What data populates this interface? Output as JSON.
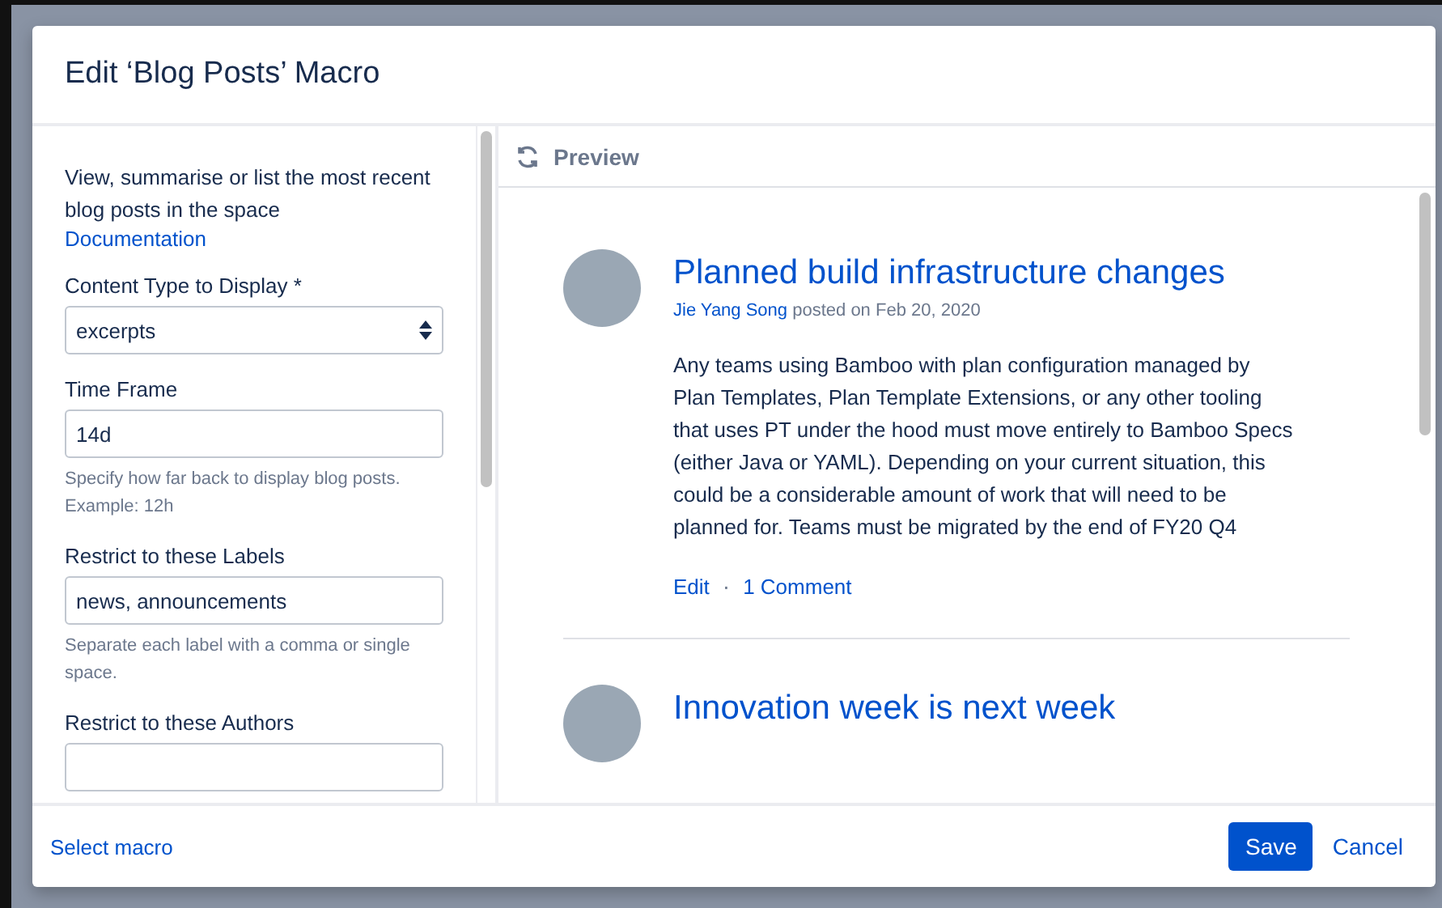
{
  "dialog": {
    "title": "Edit ‘Blog Posts’ Macro"
  },
  "sidebar": {
    "description": "View, summarise or list the most recent blog posts in the space",
    "link": "Documentation",
    "fields": [
      {
        "kind": "select",
        "label": "Content Type to Display *",
        "value": "excerpts"
      },
      {
        "kind": "text",
        "label": "Time Frame",
        "value": "14d",
        "help": "Specify how far back to display blog posts. Example: 12h"
      },
      {
        "kind": "text",
        "label": "Restrict to these Labels",
        "value": "news, announcements",
        "help": "Separate each label with a comma or single space."
      },
      {
        "kind": "text",
        "label": "Restrict to these Authors"
      }
    ]
  },
  "preview": {
    "title": "Preview",
    "posts": [
      {
        "title": "Planned build infrastructure changes",
        "author": "Jie Yang Song",
        "meta": "posted on Feb 20, 2020",
        "excerpt": "Any teams using Bamboo with plan configuration managed by Plan Templates, Plan Template Extensions, or any other tooling that uses PT under the hood must move entirely to Bamboo Specs (either Java or YAML). Depending on your current situation, this could be a considerable amount of work that will need to be planned for. Teams must be migrated by the end of FY20 Q4",
        "actions": [
          "Edit",
          "1 Comment"
        ],
        "separator": "·"
      },
      {
        "title": "Innovation week is next week"
      }
    ]
  },
  "footer": {
    "link": "Select macro",
    "buttons": [
      {
        "label": "Save",
        "kind": "primary"
      },
      {
        "label": "Cancel",
        "kind": "link"
      }
    ]
  }
}
